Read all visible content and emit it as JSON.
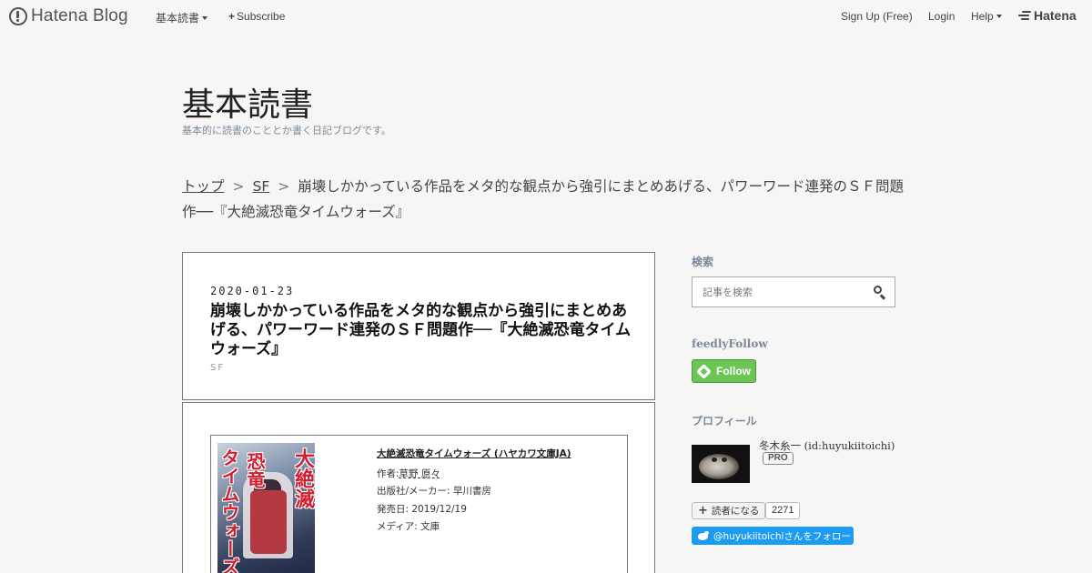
{
  "global_header": {
    "brand": "Hatena Blog",
    "read_menu": "基本読書",
    "subscribe": "Subscribe",
    "signup": "Sign Up (Free)",
    "login": "Login",
    "help": "Help",
    "hatena": "Hatena"
  },
  "blog": {
    "title": "基本読書",
    "description": "基本的に読書のこととか書く日記ブログです。"
  },
  "breadcrumb": {
    "home": "トップ",
    "category": "SF",
    "separator": ">",
    "current": "崩壊しかかっている作品をメタ的な観点から強引にまとめあげる、パワーワード連発のＳＦ問題作──『大絶滅恐竜タイムウォーズ』"
  },
  "entry": {
    "date": "2020-01-23",
    "title": "崩壊しかかっている作品をメタ的な観点から強引にまとめあげる、パワーワード連発のＳＦ問題作──『大絶滅恐竜タイムウォーズ』",
    "category": "SF"
  },
  "product": {
    "title": "大絶滅恐竜タイムウォーズ (ハヤカワ文庫JA)",
    "author_label": "作者:",
    "author": "草野 原々",
    "publisher": "出版社/メーカー: 早川書房",
    "release": "発売日: 2019/12/19",
    "media": "メディア: 文庫",
    "cover_text": [
      "大絶滅",
      "恐竜",
      "タイムウォーズ"
    ]
  },
  "sidebar": {
    "search_heading": "検索",
    "search_placeholder": "記事を検索",
    "feedly_heading": "feedlyFollow",
    "feedly_button": "Follow",
    "profile_heading": "プロフィール",
    "profile_name": "冬木糸一 (id:huyukiitoichi)",
    "pro_badge": "PRO",
    "reader_button": "読者になる",
    "reader_count": "2271",
    "twitter_button": "@huyukiitoichiさんをフォロー"
  }
}
